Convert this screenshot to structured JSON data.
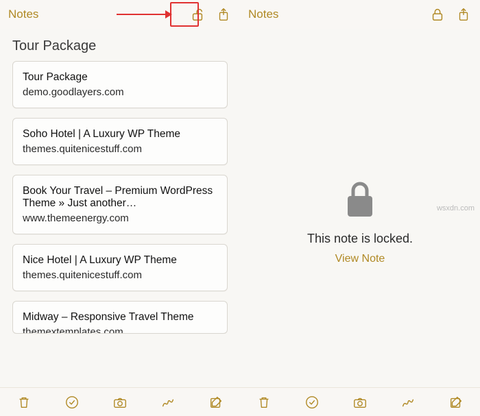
{
  "left": {
    "back_label": "Notes",
    "title": "Tour Package",
    "cards": [
      {
        "title": "Tour Package",
        "subtitle": "demo.goodlayers.com"
      },
      {
        "title": "Soho Hotel | A Luxury WP Theme",
        "subtitle": "themes.quitenicestuff.com"
      },
      {
        "title": "Book Your Travel – Premium WordPress Theme » Just another…",
        "subtitle": "www.themeenergy.com"
      },
      {
        "title": "Nice Hotel | A Luxury WP Theme",
        "subtitle": "themes.quitenicestuff.com"
      },
      {
        "title": "Midway – Responsive Travel Theme",
        "subtitle": "themextemplates.com"
      }
    ]
  },
  "right": {
    "back_label": "Notes",
    "locked_message": "This note is locked.",
    "view_label": "View Note"
  },
  "watermark": "wsxdn.com",
  "colors": {
    "accent": "#b08924",
    "highlight": "#e03131",
    "gray": "#8a8a8a"
  }
}
